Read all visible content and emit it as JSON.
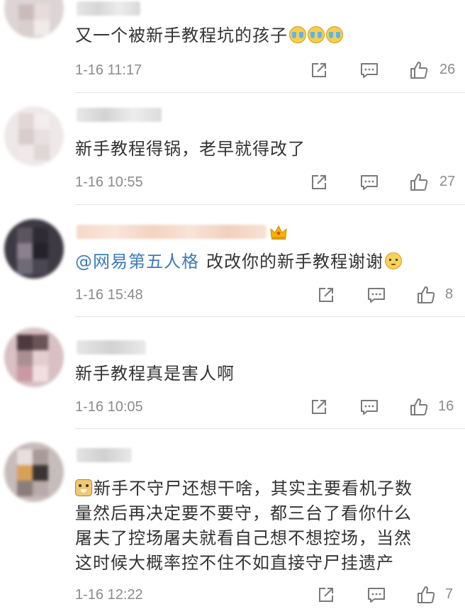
{
  "comments": [
    {
      "text": "又一个被新手教程坑的孩子",
      "emoji": [
        "cry-emoji",
        "cry-emoji",
        "cry-emoji"
      ],
      "time": "1-16 11:17",
      "likes": "26"
    },
    {
      "text": "新手教程得锅，老早就得改了",
      "time": "1-16 10:55",
      "likes": "27"
    },
    {
      "mention": "@网易第五人格",
      "text": "改改你的新手教程谢谢",
      "emoji": [
        "awkward-emoji"
      ],
      "badge": "crown-icon",
      "time": "1-16 15:48",
      "likes": "8"
    },
    {
      "text": "新手教程真是害人啊",
      "time": "1-16 10:05",
      "likes": "16"
    },
    {
      "leading_emoji": "doge-emoji",
      "lines": [
        "新手不守尸还想干啥，其实主要看机子数",
        "量然后再决定要不要守，都三台了看你什么",
        "屠夫了控场屠夫就看自己想不想控场，当然",
        "这时候大概率控不住不如直接守尸挂遗产"
      ],
      "time": "1-16 12:22",
      "likes": "7"
    }
  ],
  "icons": {
    "share": "share-icon",
    "reply": "reply-icon",
    "like": "thumb-up-icon"
  },
  "colors": {
    "text": "#333333",
    "meta": "#8b8b8b",
    "mention": "#3b7ac1",
    "icon": "#7a7a7a"
  }
}
